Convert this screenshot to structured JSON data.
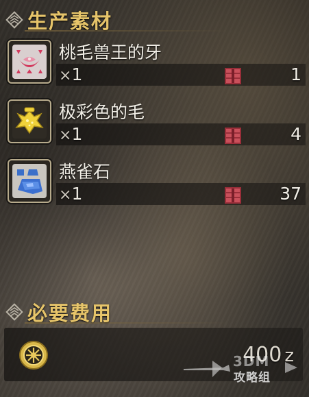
{
  "sections": {
    "materials": {
      "title": "生产素材",
      "icon": "craft-section-icon"
    },
    "cost": {
      "title": "必要费用",
      "icon": "craft-section-icon"
    }
  },
  "materials": [
    {
      "name": "桃毛兽王的牙",
      "qty_symbol": "×",
      "qty": "1",
      "owned": "1",
      "icon": "pink-fang-icon",
      "icon_color": "#e07a9a"
    },
    {
      "name": "极彩色的毛",
      "qty_symbol": "×",
      "qty": "1",
      "owned": "4",
      "icon": "yellow-pelt-icon",
      "icon_color": "#e8c83a"
    },
    {
      "name": "燕雀石",
      "qty_symbol": "×",
      "qty": "1",
      "owned": "37",
      "icon": "blue-ore-icon",
      "icon_color": "#4a7fd6"
    }
  ],
  "cost": {
    "value": "400",
    "unit": "z",
    "icon": "zenny-coin-icon",
    "icon_color": "#d9b84a"
  },
  "watermark": {
    "brand": "3DM",
    "text": "攻略组"
  },
  "colors": {
    "header_gold": "#e6c46a",
    "item_box_red": "#c0404a",
    "text_white": "#f1eee6"
  }
}
